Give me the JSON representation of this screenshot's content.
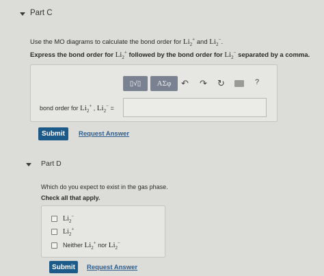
{
  "partC": {
    "title": "Part C",
    "instruction_pre": "Use the MO diagrams to calculate the bond order for ",
    "instruction_and": " and ",
    "instruction_end": ".",
    "species1": "Li",
    "species1_sub": "2",
    "species1_charge": "+",
    "species2": "Li",
    "species2_sub": "2",
    "species2_charge": "−",
    "express_pre": "Express the bond order for ",
    "express_mid": " followed by the bond order for ",
    "express_end": " separated by a comma.",
    "toolbar": {
      "template_symbol": "▯√▯",
      "greek_label": "ΑΣφ",
      "undo_glyph": "↶",
      "redo_glyph": "↷",
      "reset_glyph": "↻",
      "keyboard_glyph": "▭",
      "help_glyph": "?"
    },
    "answer_label_pre": "bond order for ",
    "answer_sep": " , ",
    "answer_eq": " =",
    "answer_value": "",
    "submit_label": "Submit",
    "request_label": "Request Answer"
  },
  "partD": {
    "title": "Part D",
    "question": "Which do you expect to exist in the gas phase.",
    "check_all": "Check all that apply.",
    "options": [
      {
        "main": "Li",
        "sub": "2",
        "charge": "−",
        "checked": false
      },
      {
        "main": "Li",
        "sub": "2",
        "charge": "+",
        "checked": false
      },
      {
        "pre": "Neither ",
        "main": "Li",
        "sub": "2",
        "charge": "+",
        "mid": " nor ",
        "main2": "Li",
        "sub2": "2",
        "charge2": "−",
        "checked": false
      }
    ],
    "submit_label": "Submit",
    "request_label": "Request Answer"
  },
  "colors": {
    "background": "#dcdcd8",
    "submit_button": "#1c5a8a",
    "link": "#2d5d8d",
    "toolbar_button": "#7a8190"
  }
}
